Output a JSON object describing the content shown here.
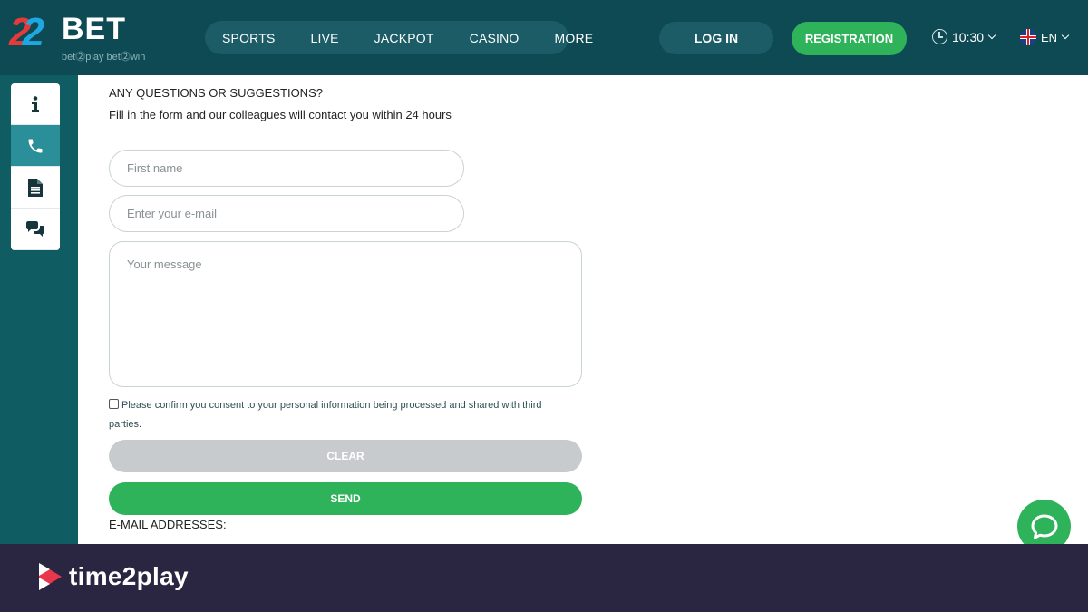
{
  "header": {
    "logo": {
      "digits": [
        "2",
        "2"
      ],
      "brand": "BET",
      "tagline": "bet⓶play bet⓶win"
    },
    "nav": [
      {
        "label": "SPORTS"
      },
      {
        "label": "LIVE"
      },
      {
        "label": "JACKPOT"
      },
      {
        "label": "CASINO"
      },
      {
        "label": "MORE"
      }
    ],
    "login_label": "LOG IN",
    "registration_label": "REGISTRATION",
    "time": "10:30",
    "language": "EN"
  },
  "sidebar": {
    "tabs": [
      {
        "icon": "info-icon",
        "active": false
      },
      {
        "icon": "phone-icon",
        "active": true
      },
      {
        "icon": "document-icon",
        "active": false
      },
      {
        "icon": "chat-icon",
        "active": false
      }
    ]
  },
  "form": {
    "title": "ANY QUESTIONS OR SUGGESTIONS?",
    "subtitle": "Fill in the form and our colleagues will contact you within 24 hours",
    "first_name_placeholder": "First name",
    "email_placeholder": "Enter your e-mail",
    "message_placeholder": "Your message",
    "consent_text": "Please confirm you consent to your personal information being processed and shared with third parties.",
    "clear_label": "CLEAR",
    "send_label": "SEND"
  },
  "emails": {
    "title": "E-MAIL ADDRESSES:"
  },
  "colors": {
    "header_bg": "#0e4a53",
    "accent_green": "#2fb35a",
    "sidebar_teal": "#0f5d63",
    "footer_bg": "#2a2540"
  },
  "footer": {
    "brand": "time2play"
  }
}
